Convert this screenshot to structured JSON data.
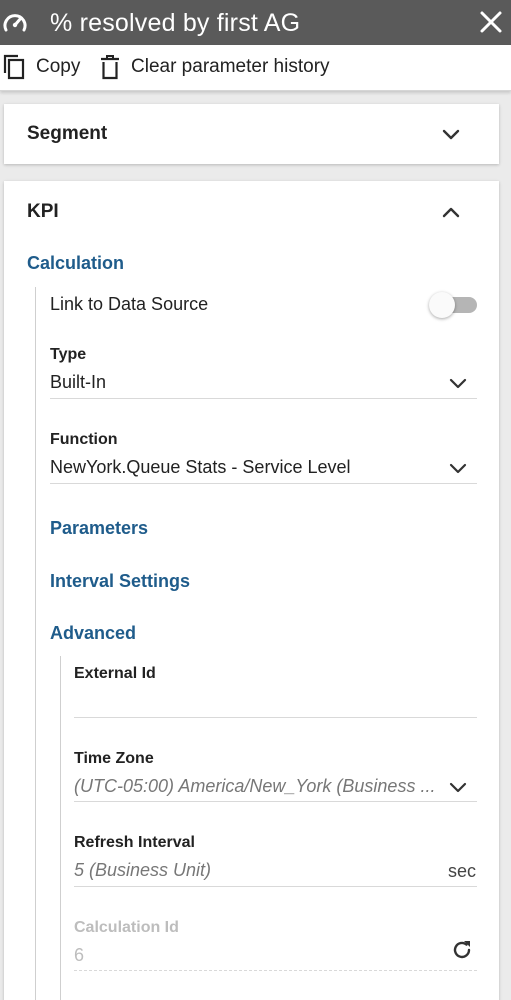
{
  "window": {
    "title": "% resolved by first AG",
    "title_icon": "gauge-icon",
    "close_icon": "close-icon"
  },
  "toolbar": {
    "copy_label": "Copy",
    "clear_history_label": "Clear parameter history"
  },
  "segment_card": {
    "title": "Segment",
    "expanded": false
  },
  "kpi_card": {
    "title": "KPI",
    "expanded": true,
    "calculation": {
      "title": "Calculation",
      "link_to_data_source": {
        "label": "Link to Data Source",
        "enabled": false
      },
      "type": {
        "label": "Type",
        "value": "Built-In"
      },
      "function": {
        "label": "Function",
        "value": "NewYork.Queue Stats - Service Level"
      },
      "parameters_title": "Parameters",
      "interval_settings_title": "Interval Settings",
      "advanced": {
        "title": "Advanced",
        "external_id": {
          "label": "External Id",
          "value": ""
        },
        "time_zone": {
          "label": "Time Zone",
          "value": "(UTC-05:00) America/New_York (Business ..."
        },
        "refresh_interval": {
          "label": "Refresh Interval",
          "value": "5 (Business Unit)",
          "unit": "sec"
        },
        "calculation_id": {
          "label": "Calculation Id",
          "value": "6"
        }
      }
    }
  },
  "colors": {
    "titlebar_bg": "#5a5a5a",
    "section_blue": "#1f5c8b",
    "page_bg": "#ebebeb"
  }
}
